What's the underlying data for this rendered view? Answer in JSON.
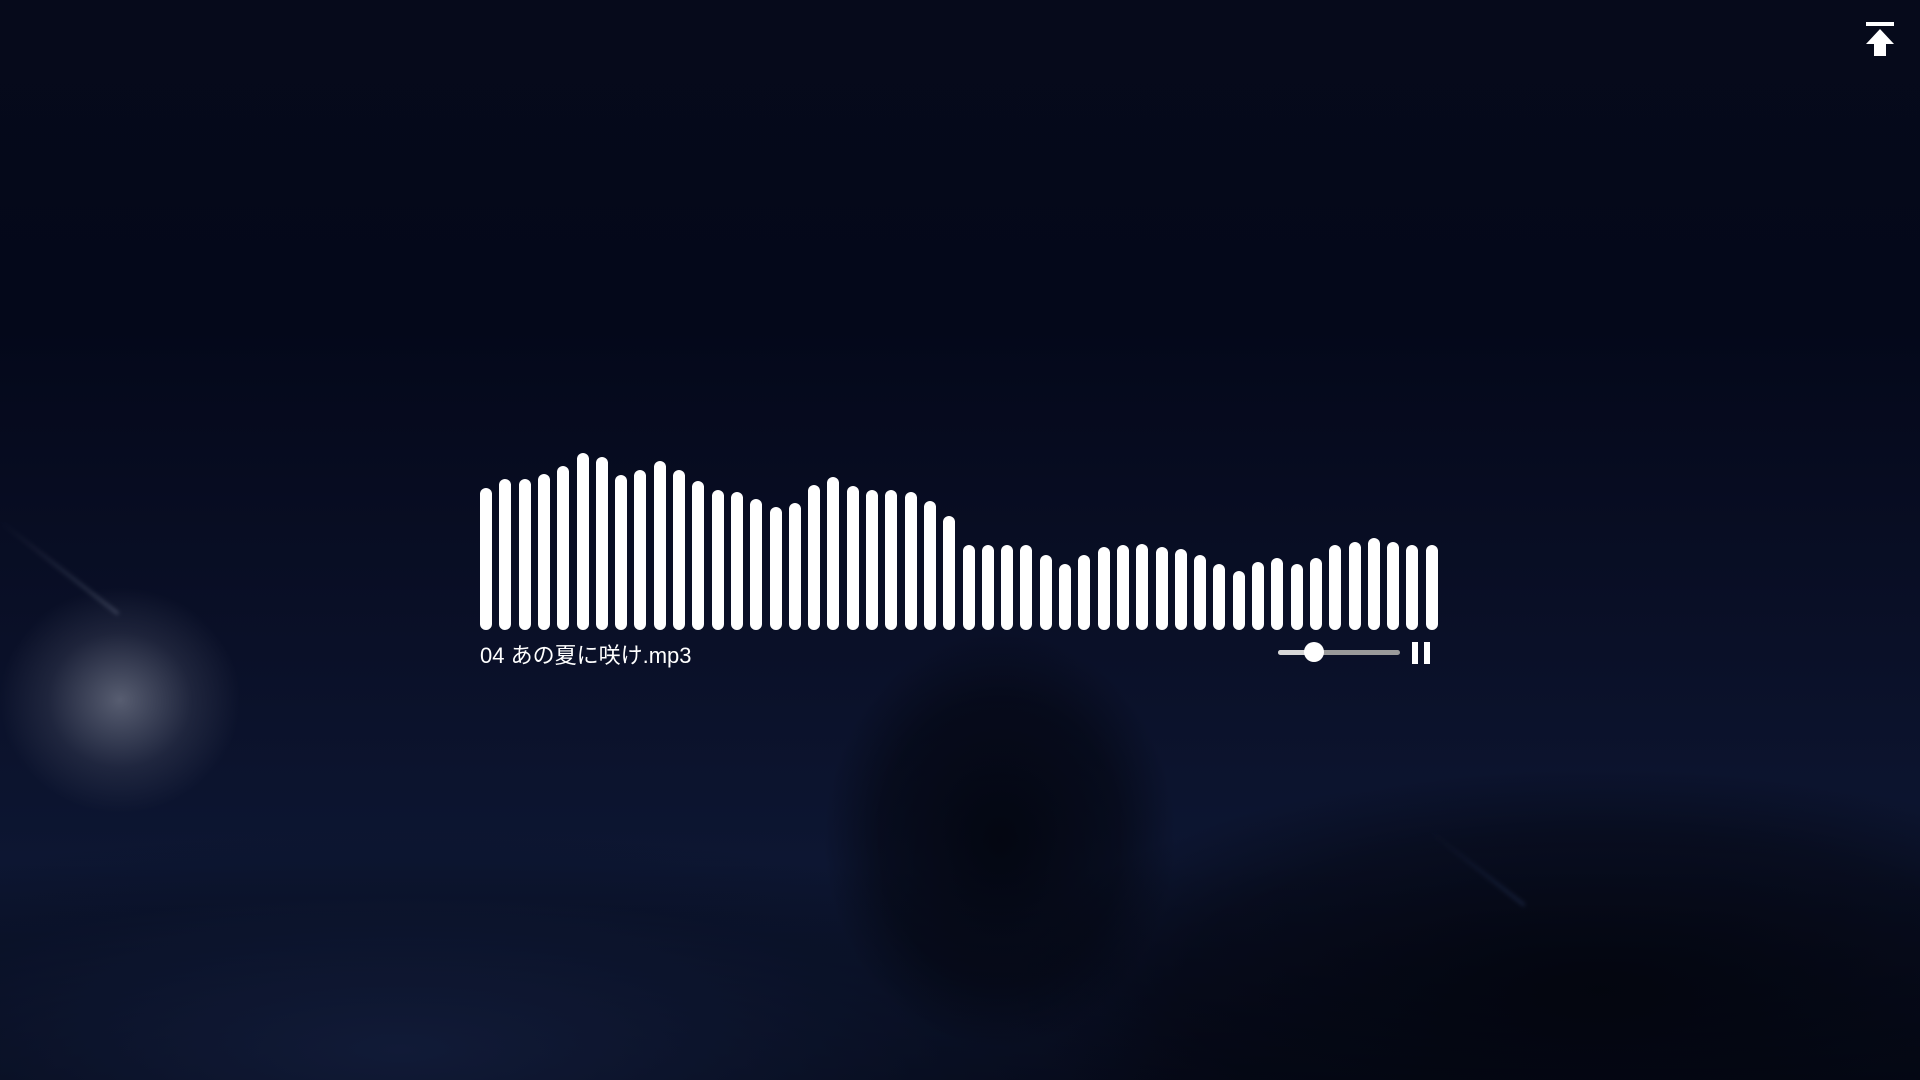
{
  "player": {
    "track_title": "04 あの夏に咲け.mp3",
    "volume": 0.25,
    "state": "playing",
    "pause_icon": "pause-icon",
    "bar_color": "#ffffff",
    "visualizer_levels": [
      0.77,
      0.82,
      0.82,
      0.85,
      0.89,
      0.96,
      0.94,
      0.84,
      0.87,
      0.92,
      0.87,
      0.81,
      0.76,
      0.75,
      0.71,
      0.67,
      0.69,
      0.79,
      0.83,
      0.78,
      0.76,
      0.76,
      0.75,
      0.7,
      0.62,
      0.46,
      0.46,
      0.46,
      0.46,
      0.41,
      0.36,
      0.41,
      0.45,
      0.46,
      0.47,
      0.45,
      0.44,
      0.41,
      0.36,
      0.32,
      0.37,
      0.39,
      0.36,
      0.39,
      0.46,
      0.48,
      0.5,
      0.48,
      0.46,
      0.46
    ]
  },
  "top_button": {
    "icon": "arrow-up-to-top-icon"
  },
  "background": {
    "base_color": "#050818",
    "accent_color": "#0d1632"
  }
}
